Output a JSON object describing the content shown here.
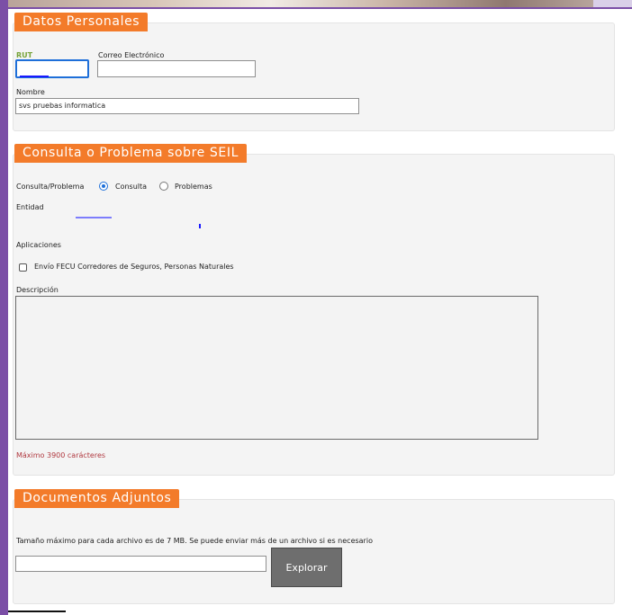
{
  "datos_personales": {
    "legend": "Datos Personales",
    "rut_label": "RUT",
    "rut_value": "",
    "correo_label": "Correo Electrónico",
    "correo_value": "",
    "nombre_label": "Nombre",
    "nombre_value": "svs pruebas informatica"
  },
  "consulta": {
    "legend": "Consulta o Problema sobre SEIL",
    "tipo_label": "Consulta/Problema",
    "options": [
      {
        "label": "Consulta",
        "selected": true
      },
      {
        "label": "Problemas",
        "selected": false
      }
    ],
    "entidad_label": "Entidad",
    "aplicaciones_label": "Aplicaciones",
    "aplicacion_item": "Envío FECU Corredores de Seguros, Personas Naturales",
    "descripcion_label": "Descripción",
    "descripcion_value": "",
    "max_chars_note": "Máximo 3900 carácteres"
  },
  "documentos": {
    "legend": "Documentos Adjuntos",
    "info": "Tamaño máximo para cada archivo es de 7 MB. Se puede enviar más de un archivo si es necesario",
    "file_value": "",
    "browse_label": "Explorar"
  },
  "colors": {
    "legend_bg": "#f37b2a",
    "focus_blue": "#1e6fd9",
    "frame_purple": "#7b4fa6",
    "rut_green": "#77a33a",
    "note_red": "#b0383f"
  }
}
